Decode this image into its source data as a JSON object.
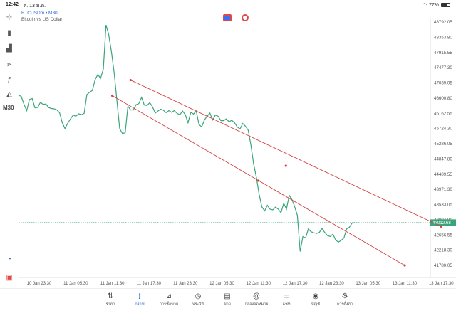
{
  "status": {
    "time": "12:42",
    "date": "ส. 13 ม.ค.",
    "battery": "77%",
    "battery_level": 0.77
  },
  "symbol": {
    "name": "BTCUSDm • M30",
    "description": "Bitcoin vs US Dollar"
  },
  "timeframe": "M30",
  "left_tools": [
    {
      "icon": "crosshair-icon",
      "glyph": "⊹"
    },
    {
      "icon": "candles-icon",
      "glyph": "▮"
    },
    {
      "icon": "chart-type-icon",
      "glyph": "▟"
    },
    {
      "icon": "indicators-icon",
      "glyph": "⫸"
    },
    {
      "icon": "function-icon",
      "glyph": "ƒ"
    },
    {
      "icon": "shapes-icon",
      "glyph": "◭"
    }
  ],
  "current_price": "43012.68",
  "chart_data": {
    "type": "line",
    "title": "",
    "line_color": "#3aa57a",
    "y_axis": {
      "min": 41780.05,
      "max": 48792.05,
      "ticks": [
        "48792.05",
        "48353.80",
        "47915.55",
        "47477.30",
        "47039.05",
        "46600.80",
        "46162.55",
        "45724.30",
        "45286.05",
        "44847.80",
        "44409.55",
        "43971.30",
        "43533.05",
        "43094.80",
        "42656.55",
        "42218.30",
        "41780.05"
      ]
    },
    "x_axis": {
      "labels": [
        "10 Jan 23:30",
        "11 Jan 05:30",
        "11 Jan 11:30",
        "11 Jan 17:30",
        "11 Jan 23:30",
        "12 Jan 05:30",
        "12 Jan 11:30",
        "12 Jan 17:30",
        "12 Jan 23:30",
        "13 Jan 05:30",
        "13 Jan 11:30",
        "13 Jan 17:30"
      ]
    },
    "series": [
      {
        "values": [
          46680,
          46650,
          46420,
          46240,
          46560,
          46590,
          46320,
          46330,
          46480,
          46420,
          46430,
          46330,
          46300,
          46290,
          46260,
          46180,
          45890,
          45720,
          45880,
          46000,
          46110,
          46080,
          46150,
          46120,
          46160,
          46700,
          46770,
          46820,
          47130,
          47280,
          47170,
          47430,
          48710,
          48430,
          47920,
          47320,
          46520,
          45720,
          45580,
          45600,
          46370,
          46260,
          46260,
          46410,
          46440,
          46620,
          46400,
          46390,
          46470,
          46350,
          46170,
          46230,
          46280,
          46250,
          46180,
          46240,
          46190,
          46240,
          46160,
          46120,
          46230,
          46120,
          45890,
          46190,
          46140,
          46230,
          45840,
          45770,
          45970,
          46080,
          46170,
          45970,
          46110,
          46080,
          45950,
          45950,
          46000,
          45920,
          45960,
          45890,
          45770,
          45710,
          45870,
          45790,
          45680,
          45240,
          44700,
          44310,
          43830,
          43470,
          43350,
          43510,
          43400,
          43380,
          43460,
          43400,
          43300,
          43570,
          43400,
          43800,
          43680,
          43470,
          43220,
          42180,
          42610,
          42570,
          42830,
          42750,
          42720,
          42700,
          42730,
          42840,
          42730,
          42640,
          42610,
          42680,
          42510,
          42450,
          42500,
          42570,
          42830,
          42880,
          43000,
          43012.68
        ]
      }
    ]
  },
  "trendlines": [
    {
      "color": "#d44040",
      "from_date": "11 Jan 11:30",
      "from_price": 46670,
      "mid_price": 44220,
      "to_date": "13 Jan 11:30",
      "to_price": 41780
    },
    {
      "color": "#d44040",
      "from_date": "11 Jan 20:00",
      "from_price": 47120,
      "mid_price": 44650,
      "to_date": "13 Jan 17:30",
      "to_price": 42900
    }
  ],
  "nav": [
    {
      "label": "ราคา",
      "icon": "quotes-icon",
      "glyph": "⇅"
    },
    {
      "label": "กราฟ",
      "icon": "chart-icon",
      "glyph": "⫾",
      "active": true
    },
    {
      "label": "การซื้อขาย",
      "icon": "trade-icon",
      "glyph": "⊿"
    },
    {
      "label": "ประวัติ",
      "icon": "history-icon",
      "glyph": "◷"
    },
    {
      "label": "ข่าว",
      "icon": "news-icon",
      "glyph": "▤"
    },
    {
      "label": "กล่องจดหมาย",
      "icon": "mailbox-icon",
      "glyph": "@"
    },
    {
      "label": "แชท",
      "icon": "chat-icon",
      "glyph": "▭"
    },
    {
      "label": "บัญชี",
      "icon": "account-icon",
      "glyph": "◉"
    },
    {
      "label": "การตั้งค่า",
      "icon": "settings-icon",
      "glyph": "⚙"
    }
  ]
}
